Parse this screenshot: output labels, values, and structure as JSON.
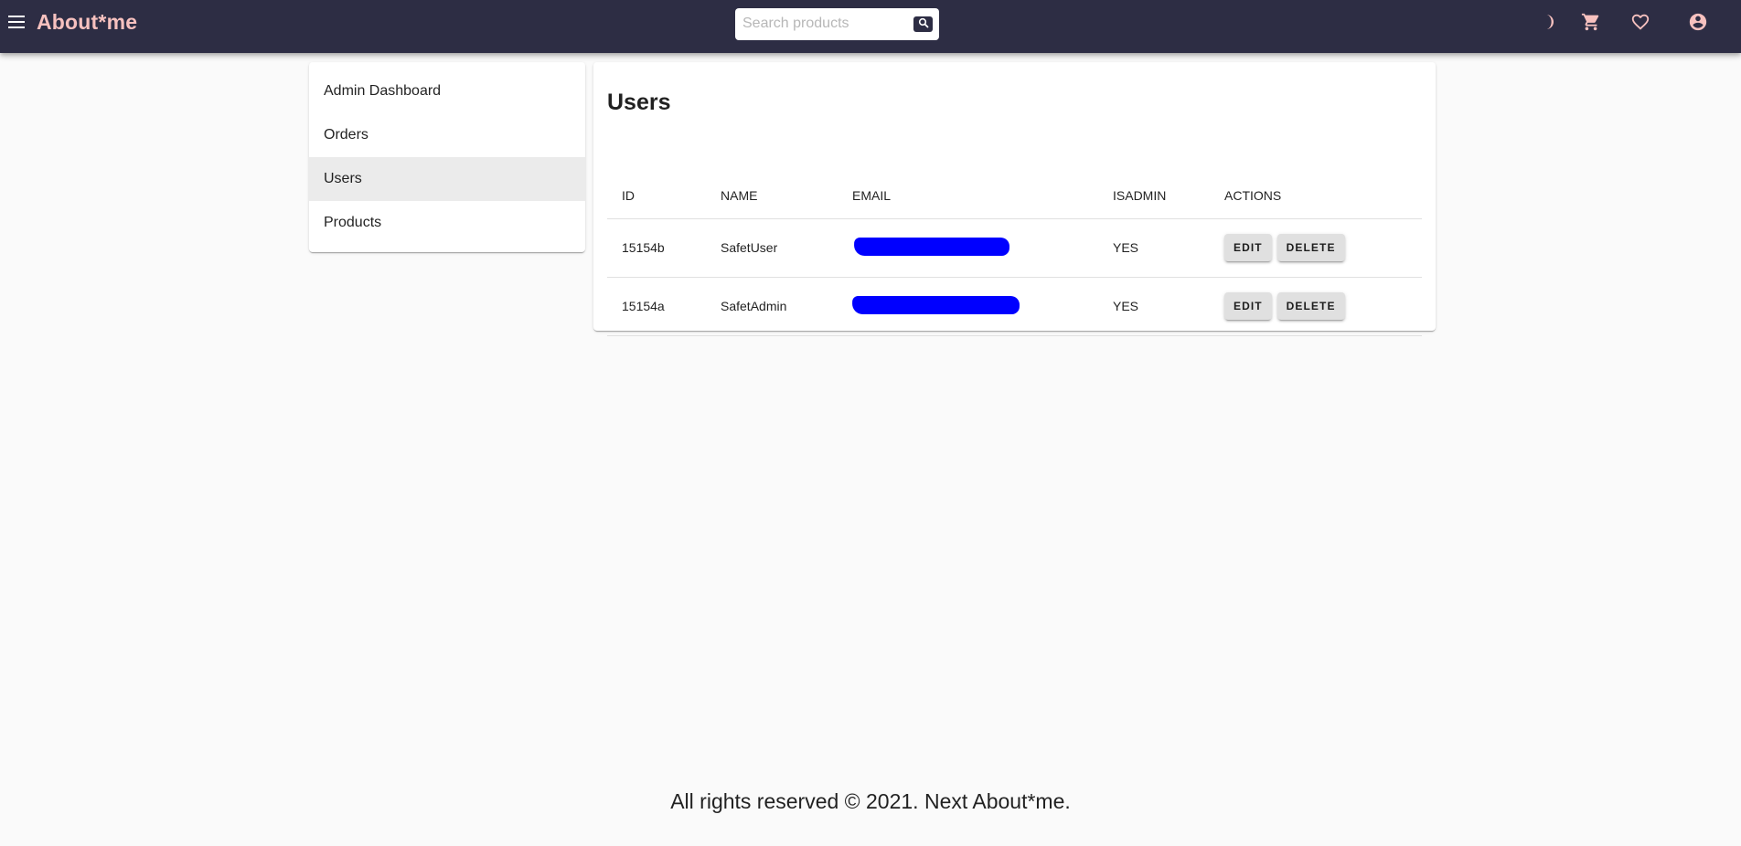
{
  "header": {
    "brand": "About*me",
    "search_placeholder": "Search products",
    "search_value": "",
    "icons": [
      "menu-icon",
      "search-icon",
      "dark-mode-icon",
      "cart-icon",
      "heart-icon",
      "account-icon"
    ],
    "colors": {
      "bar": "#2d2d44",
      "brand": "#f7c1bf",
      "icon": "#f7c1bf"
    }
  },
  "sidebar": {
    "items": [
      {
        "label": "Admin Dashboard",
        "selected": false
      },
      {
        "label": "Orders",
        "selected": false
      },
      {
        "label": "Users",
        "selected": true
      },
      {
        "label": "Products",
        "selected": false
      }
    ]
  },
  "main": {
    "title": "Users",
    "table": {
      "columns": [
        "ID",
        "NAME",
        "EMAIL",
        "ISADMIN",
        "ACTIONS"
      ],
      "rows": [
        {
          "id": "15154b",
          "name": "SafetUser",
          "email_redacted": true,
          "isadmin": "YES",
          "edit_label": "EDIT",
          "delete_label": "DELETE"
        },
        {
          "id": "15154a",
          "name": "SafetAdmin",
          "email_redacted": true,
          "isadmin": "YES",
          "edit_label": "EDIT",
          "delete_label": "DELETE"
        }
      ]
    },
    "redaction_color": "#0000ff"
  },
  "footer": {
    "text": "All rights reserved © 2021. Next About*me."
  }
}
